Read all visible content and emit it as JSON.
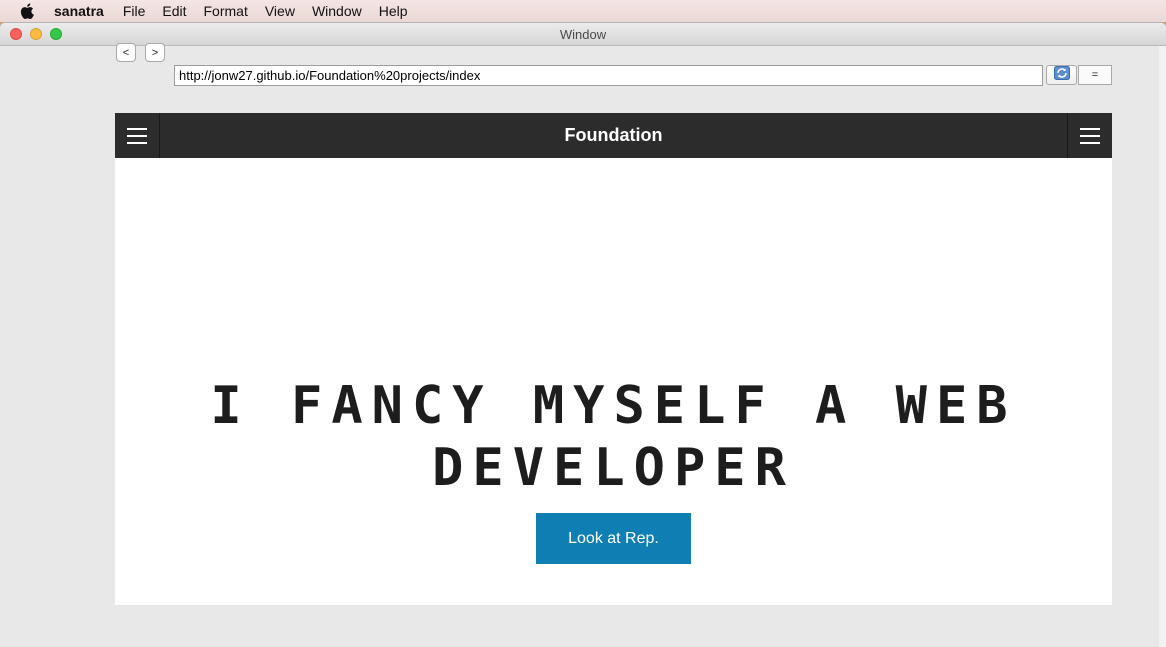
{
  "menubar": {
    "apple_icon": "apple-icon",
    "app_name": "sanatra",
    "items": [
      "File",
      "Edit",
      "Format",
      "View",
      "Window",
      "Help"
    ]
  },
  "window": {
    "title": "Window"
  },
  "browser": {
    "back_label": "<",
    "forward_label": ">",
    "url": "http://jonw27.github.io/Foundation%20projects/index",
    "refresh_icon": "refresh-icon",
    "menu_label": "="
  },
  "site": {
    "brand": "Foundation",
    "hero_title": "I FANCY MYSELF A WEB DEVELOPER",
    "cta_label": "Look at Rep.",
    "topbar_color": "#2c2c2c",
    "cta_color": "#0f7fb3"
  }
}
